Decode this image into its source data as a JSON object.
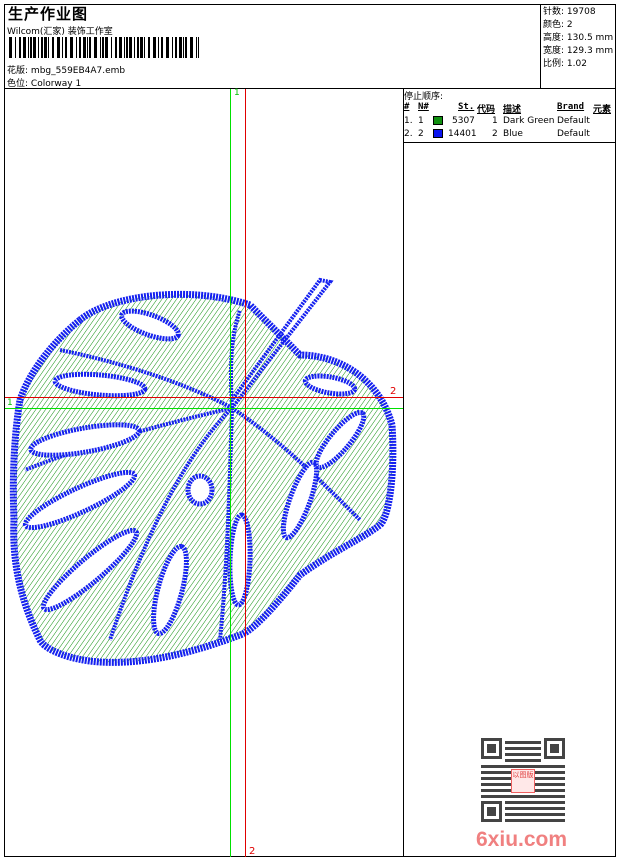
{
  "header": {
    "title": "生产作业图",
    "company": "Wilcom(汇家) 装饰工作室",
    "design_label": "花版:",
    "design_value": "mbg_559EB4A7.emb",
    "colorway_label": "色位:",
    "colorway_value": "Colorway 1"
  },
  "stats": [
    {
      "label": "针数:",
      "value": "19708"
    },
    {
      "label": "颜色:",
      "value": "2"
    },
    {
      "label": "高度:",
      "value": "130.5 mm"
    },
    {
      "label": "宽度:",
      "value": "129.3 mm"
    },
    {
      "label": "比例:",
      "value": "1.02"
    }
  ],
  "stop_sequence": {
    "title": "停止顺序:",
    "columns": [
      "#",
      "N#",
      "St.",
      "代码",
      "描述",
      "Brand",
      "元素"
    ],
    "rows": [
      {
        "index": "1.",
        "n": "1",
        "color": "#109010",
        "stitches": "5307",
        "code": "1",
        "description": "Dark Green",
        "brand": "Default"
      },
      {
        "index": "2.",
        "n": "2",
        "color": "#0a14f0",
        "stitches": "14401",
        "code": "2",
        "description": "Blue",
        "brand": "Default"
      }
    ]
  },
  "guides": {
    "green_label": "1",
    "red_label": "2",
    "green_color": "#00e000",
    "red_color": "#e00000"
  },
  "watermark": {
    "text": "6xiu.com",
    "seal": "以图版"
  }
}
